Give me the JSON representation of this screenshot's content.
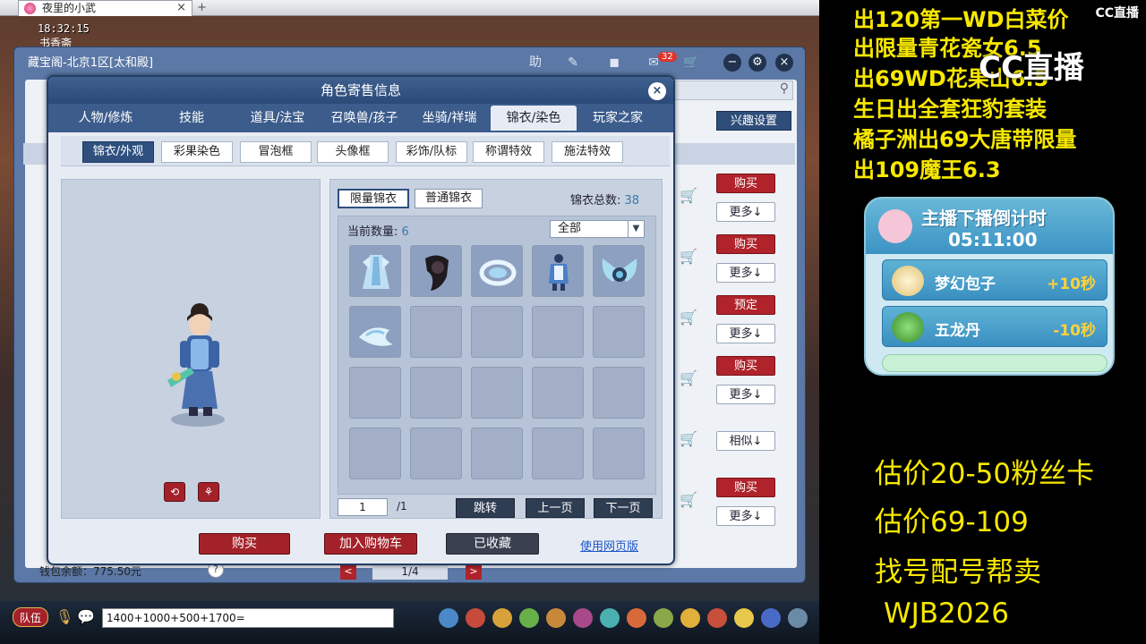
{
  "browser": {
    "tab_title": "夜里的小武",
    "new_tab": "+",
    "close": "×"
  },
  "game": {
    "clock": "18:32:15",
    "location": "书香斋"
  },
  "market": {
    "title": "藏宝阁-北京1区[太和殿]",
    "toolbar": {
      "help": "助",
      "msg_badge": "32"
    },
    "interest_button": "兴趣设置",
    "row_buttons": [
      {
        "action": "购买",
        "more": "更多↓"
      },
      {
        "action": "购买",
        "more": "更多↓"
      },
      {
        "action": "预定",
        "more": "更多↓"
      },
      {
        "action": "购买",
        "more": "更多↓"
      },
      {
        "action": "",
        "more": "相似↓"
      },
      {
        "action": "购买",
        "more": "更多↓"
      }
    ],
    "wallet": "钱包余额：775.50元",
    "help": "?",
    "pager": {
      "prev": "<",
      "page": "1/4",
      "next": ">"
    }
  },
  "dialog": {
    "title": "角色寄售信息",
    "close": "×",
    "tabs": [
      "人物/修炼",
      "技能",
      "道具/法宝",
      "召唤兽/孩子",
      "坐骑/祥瑞",
      "锦衣/染色",
      "玩家之家"
    ],
    "active_tab": 5,
    "subtabs": [
      "锦衣/外观",
      "彩果染色",
      "冒泡框",
      "头像框",
      "彩饰/队标",
      "称谓特效",
      "施法特效"
    ],
    "active_subtab": 0,
    "preview": {
      "rotate": "⟲",
      "action": "⚘"
    },
    "items": {
      "type_tabs": [
        "限量锦衣",
        "普通锦衣"
      ],
      "active_type": 0,
      "total_label": "锦衣总数:",
      "total_value": "38",
      "count_label": "当前数量:",
      "count_value": "6",
      "filter": "全部",
      "page_input": "1",
      "page_total": "/1",
      "buttons": {
        "jump": "跳转",
        "prev": "上一页",
        "next": "下一页"
      }
    },
    "footer": {
      "buy": "购买",
      "add_cart": "加入购物车",
      "favorited": "已收藏",
      "web_version": "使用网页版"
    }
  },
  "chat": {
    "team": "队伍",
    "input": "1400+1000+500+1700="
  },
  "overlay": {
    "cc_logo": "CC直播",
    "cc_big": "CC直播",
    "ads": [
      "出120第一WD白菜价",
      "出限量青花瓷女6.5",
      "出69WD花果山6.5",
      "生日出全套狂豹套装",
      "橘子洲出69大唐带限量",
      "出109魔王6.3"
    ],
    "countdown": {
      "title": "主播下播倒计时",
      "time": "05:11:00",
      "items": [
        {
          "name": "梦幻包子",
          "value": "+10秒"
        },
        {
          "name": "五龙丹",
          "value": "-10秒"
        }
      ]
    },
    "notes": [
      "估价20-50粉丝卡",
      "估价69-109",
      "找号配号帮卖",
      "WJB2026"
    ]
  },
  "colors": {
    "accent_red": "#b0232a",
    "panel_blue": "#2f507f",
    "overlay_yellow": "#f7e800"
  }
}
